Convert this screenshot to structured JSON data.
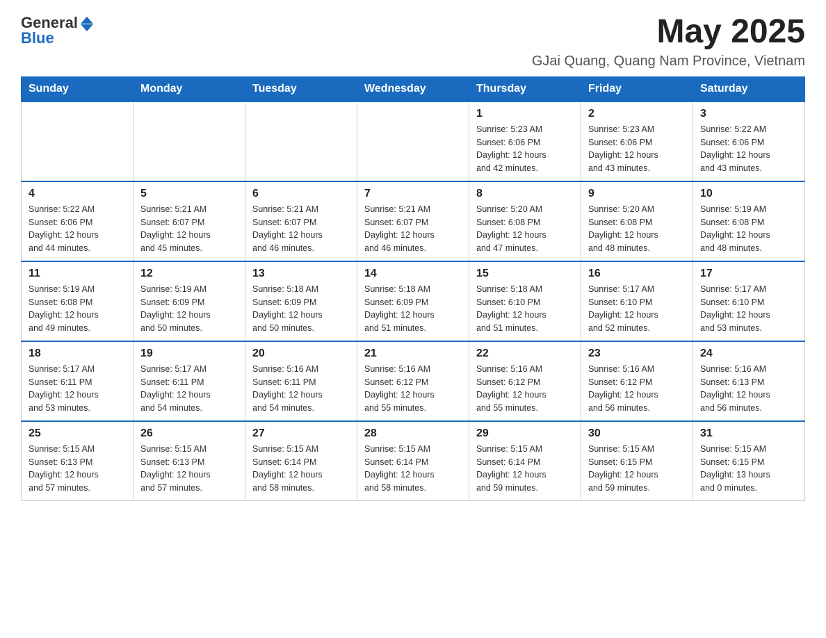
{
  "header": {
    "logo_general": "General",
    "logo_blue": "Blue",
    "month_year": "May 2025",
    "location": "GJai Quang, Quang Nam Province, Vietnam"
  },
  "days_of_week": [
    "Sunday",
    "Monday",
    "Tuesday",
    "Wednesday",
    "Thursday",
    "Friday",
    "Saturday"
  ],
  "weeks": [
    {
      "days": [
        {
          "number": "",
          "info": ""
        },
        {
          "number": "",
          "info": ""
        },
        {
          "number": "",
          "info": ""
        },
        {
          "number": "",
          "info": ""
        },
        {
          "number": "1",
          "info": "Sunrise: 5:23 AM\nSunset: 6:06 PM\nDaylight: 12 hours\nand 42 minutes."
        },
        {
          "number": "2",
          "info": "Sunrise: 5:23 AM\nSunset: 6:06 PM\nDaylight: 12 hours\nand 43 minutes."
        },
        {
          "number": "3",
          "info": "Sunrise: 5:22 AM\nSunset: 6:06 PM\nDaylight: 12 hours\nand 43 minutes."
        }
      ]
    },
    {
      "days": [
        {
          "number": "4",
          "info": "Sunrise: 5:22 AM\nSunset: 6:06 PM\nDaylight: 12 hours\nand 44 minutes."
        },
        {
          "number": "5",
          "info": "Sunrise: 5:21 AM\nSunset: 6:07 PM\nDaylight: 12 hours\nand 45 minutes."
        },
        {
          "number": "6",
          "info": "Sunrise: 5:21 AM\nSunset: 6:07 PM\nDaylight: 12 hours\nand 46 minutes."
        },
        {
          "number": "7",
          "info": "Sunrise: 5:21 AM\nSunset: 6:07 PM\nDaylight: 12 hours\nand 46 minutes."
        },
        {
          "number": "8",
          "info": "Sunrise: 5:20 AM\nSunset: 6:08 PM\nDaylight: 12 hours\nand 47 minutes."
        },
        {
          "number": "9",
          "info": "Sunrise: 5:20 AM\nSunset: 6:08 PM\nDaylight: 12 hours\nand 48 minutes."
        },
        {
          "number": "10",
          "info": "Sunrise: 5:19 AM\nSunset: 6:08 PM\nDaylight: 12 hours\nand 48 minutes."
        }
      ]
    },
    {
      "days": [
        {
          "number": "11",
          "info": "Sunrise: 5:19 AM\nSunset: 6:08 PM\nDaylight: 12 hours\nand 49 minutes."
        },
        {
          "number": "12",
          "info": "Sunrise: 5:19 AM\nSunset: 6:09 PM\nDaylight: 12 hours\nand 50 minutes."
        },
        {
          "number": "13",
          "info": "Sunrise: 5:18 AM\nSunset: 6:09 PM\nDaylight: 12 hours\nand 50 minutes."
        },
        {
          "number": "14",
          "info": "Sunrise: 5:18 AM\nSunset: 6:09 PM\nDaylight: 12 hours\nand 51 minutes."
        },
        {
          "number": "15",
          "info": "Sunrise: 5:18 AM\nSunset: 6:10 PM\nDaylight: 12 hours\nand 51 minutes."
        },
        {
          "number": "16",
          "info": "Sunrise: 5:17 AM\nSunset: 6:10 PM\nDaylight: 12 hours\nand 52 minutes."
        },
        {
          "number": "17",
          "info": "Sunrise: 5:17 AM\nSunset: 6:10 PM\nDaylight: 12 hours\nand 53 minutes."
        }
      ]
    },
    {
      "days": [
        {
          "number": "18",
          "info": "Sunrise: 5:17 AM\nSunset: 6:11 PM\nDaylight: 12 hours\nand 53 minutes."
        },
        {
          "number": "19",
          "info": "Sunrise: 5:17 AM\nSunset: 6:11 PM\nDaylight: 12 hours\nand 54 minutes."
        },
        {
          "number": "20",
          "info": "Sunrise: 5:16 AM\nSunset: 6:11 PM\nDaylight: 12 hours\nand 54 minutes."
        },
        {
          "number": "21",
          "info": "Sunrise: 5:16 AM\nSunset: 6:12 PM\nDaylight: 12 hours\nand 55 minutes."
        },
        {
          "number": "22",
          "info": "Sunrise: 5:16 AM\nSunset: 6:12 PM\nDaylight: 12 hours\nand 55 minutes."
        },
        {
          "number": "23",
          "info": "Sunrise: 5:16 AM\nSunset: 6:12 PM\nDaylight: 12 hours\nand 56 minutes."
        },
        {
          "number": "24",
          "info": "Sunrise: 5:16 AM\nSunset: 6:13 PM\nDaylight: 12 hours\nand 56 minutes."
        }
      ]
    },
    {
      "days": [
        {
          "number": "25",
          "info": "Sunrise: 5:15 AM\nSunset: 6:13 PM\nDaylight: 12 hours\nand 57 minutes."
        },
        {
          "number": "26",
          "info": "Sunrise: 5:15 AM\nSunset: 6:13 PM\nDaylight: 12 hours\nand 57 minutes."
        },
        {
          "number": "27",
          "info": "Sunrise: 5:15 AM\nSunset: 6:14 PM\nDaylight: 12 hours\nand 58 minutes."
        },
        {
          "number": "28",
          "info": "Sunrise: 5:15 AM\nSunset: 6:14 PM\nDaylight: 12 hours\nand 58 minutes."
        },
        {
          "number": "29",
          "info": "Sunrise: 5:15 AM\nSunset: 6:14 PM\nDaylight: 12 hours\nand 59 minutes."
        },
        {
          "number": "30",
          "info": "Sunrise: 5:15 AM\nSunset: 6:15 PM\nDaylight: 12 hours\nand 59 minutes."
        },
        {
          "number": "31",
          "info": "Sunrise: 5:15 AM\nSunset: 6:15 PM\nDaylight: 13 hours\nand 0 minutes."
        }
      ]
    }
  ]
}
